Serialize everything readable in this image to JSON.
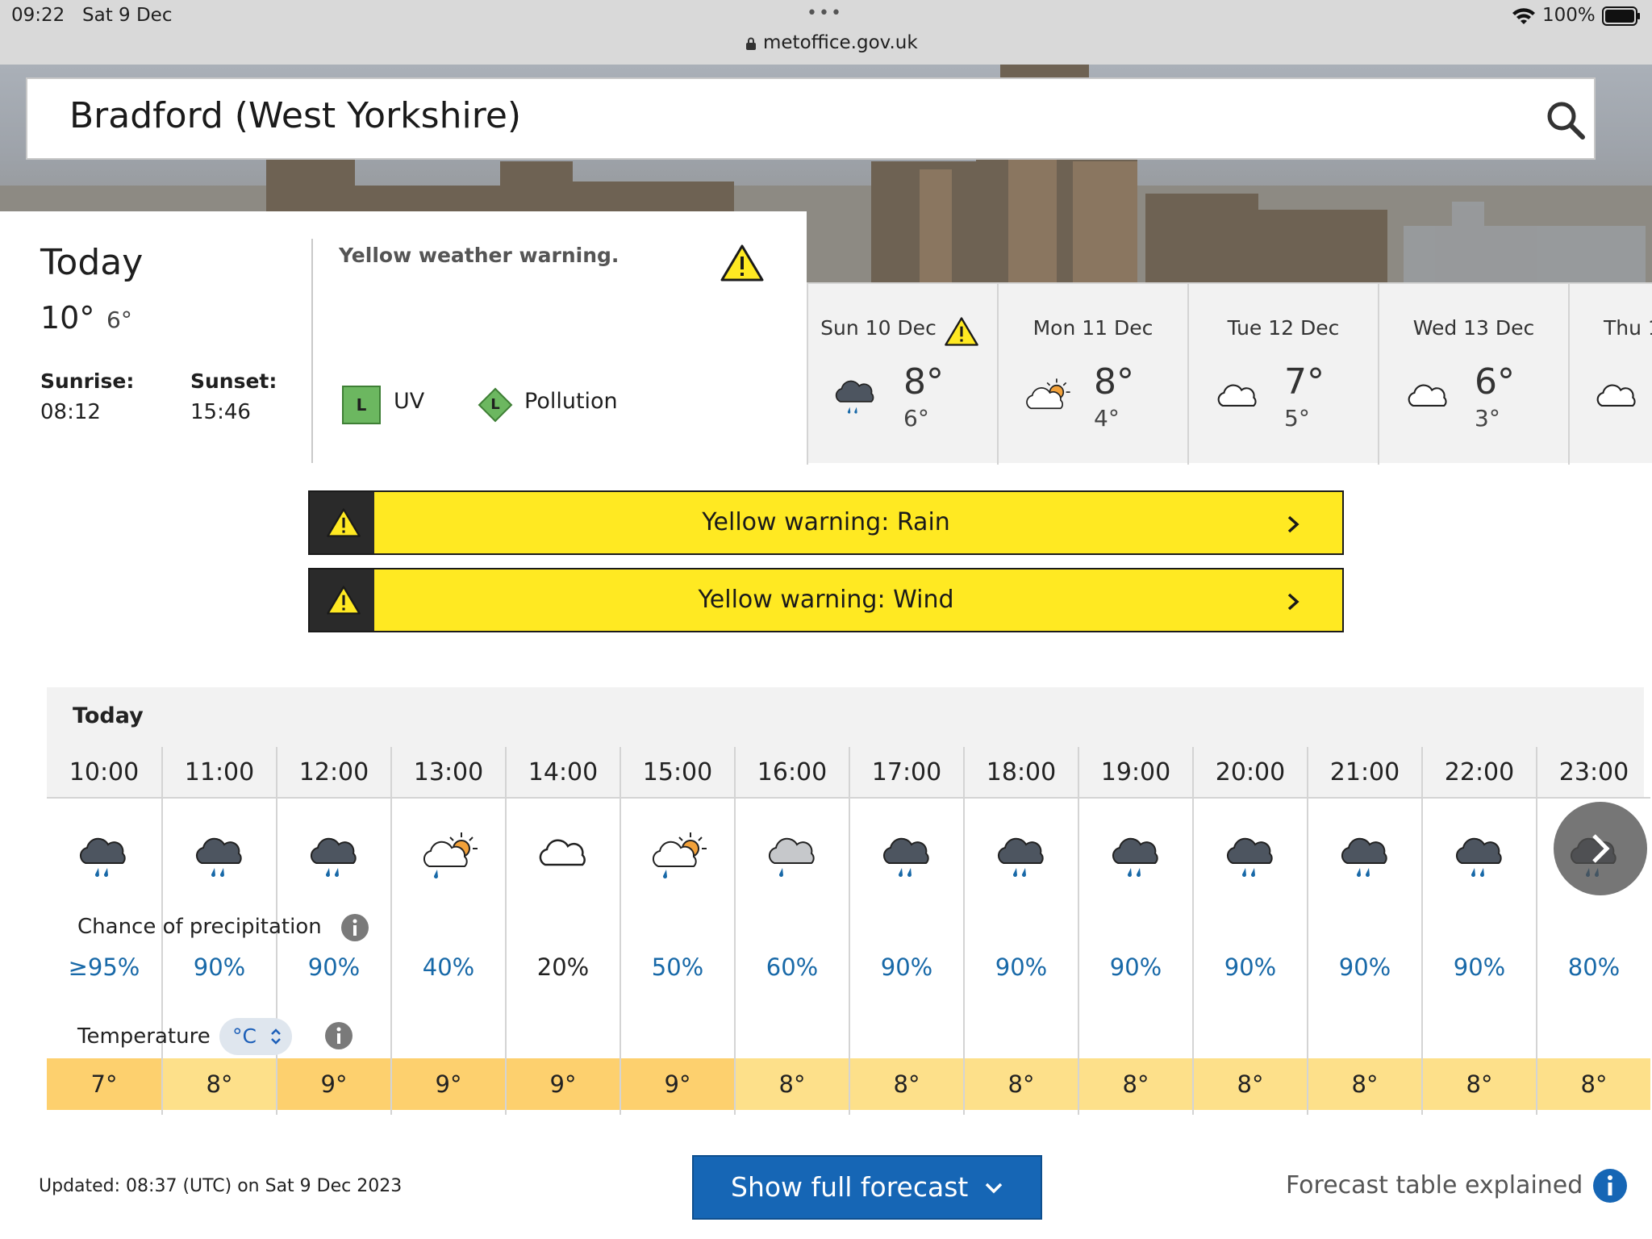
{
  "status_bar": {
    "time": "09:22",
    "date": "Sat 9 Dec",
    "url": "metoffice.gov.uk",
    "battery": "100%"
  },
  "search": {
    "location": "Bradford (West Yorkshire)"
  },
  "today": {
    "title": "Today",
    "high": "10°",
    "low": "6°",
    "sunrise_label": "Sunrise:",
    "sunrise_time": "08:12",
    "sunset_label": "Sunset:",
    "sunset_time": "15:46",
    "warning_text": "Yellow weather warning.",
    "uv_badge": "L",
    "uv_label": "UV",
    "pollution_badge": "L",
    "pollution_label": "Pollution"
  },
  "days": [
    {
      "name": "Sun 10 Dec",
      "high": "8°",
      "low": "6°",
      "icon": "heavy-rain-cloud-icon",
      "warning": true
    },
    {
      "name": "Mon 11 Dec",
      "high": "8°",
      "low": "4°",
      "icon": "sunny-intervals-icon",
      "warning": false
    },
    {
      "name": "Tue 12 Dec",
      "high": "7°",
      "low": "5°",
      "icon": "cloud-icon",
      "warning": false
    },
    {
      "name": "Wed 13 Dec",
      "high": "6°",
      "low": "3°",
      "icon": "cloud-icon",
      "warning": false
    },
    {
      "name": "Thu 1",
      "high": "",
      "low": "",
      "icon": "cloud-icon",
      "warning": false
    }
  ],
  "warnings": [
    {
      "label": "Yellow warning: Rain"
    },
    {
      "label": "Yellow warning: Wind"
    }
  ],
  "hourly": {
    "day_label": "Today",
    "precip_label": "Chance of precipitation",
    "temp_label": "Temperature",
    "unit": "°C",
    "hours": [
      {
        "time": "10:00",
        "icon": "heavy-rain-icon",
        "precip": "≥95%",
        "temp": "7°"
      },
      {
        "time": "11:00",
        "icon": "heavy-rain-icon",
        "precip": "90%",
        "temp": "8°"
      },
      {
        "time": "12:00",
        "icon": "heavy-rain-icon",
        "precip": "90%",
        "temp": "9°"
      },
      {
        "time": "13:00",
        "icon": "sunny-shower-icon",
        "precip": "40%",
        "temp": "9°"
      },
      {
        "time": "14:00",
        "icon": "cloud-icon",
        "precip": "20%",
        "temp": "9°"
      },
      {
        "time": "15:00",
        "icon": "sunny-shower-icon",
        "precip": "50%",
        "temp": "9°"
      },
      {
        "time": "16:00",
        "icon": "light-shower-icon",
        "precip": "60%",
        "temp": "8°"
      },
      {
        "time": "17:00",
        "icon": "heavy-rain-icon",
        "precip": "90%",
        "temp": "8°"
      },
      {
        "time": "18:00",
        "icon": "heavy-rain-icon",
        "precip": "90%",
        "temp": "8°"
      },
      {
        "time": "19:00",
        "icon": "heavy-rain-icon",
        "precip": "90%",
        "temp": "8°"
      },
      {
        "time": "20:00",
        "icon": "heavy-rain-icon",
        "precip": "90%",
        "temp": "8°"
      },
      {
        "time": "21:00",
        "icon": "heavy-rain-icon",
        "precip": "90%",
        "temp": "8°"
      },
      {
        "time": "22:00",
        "icon": "heavy-rain-icon",
        "precip": "90%",
        "temp": "8°"
      },
      {
        "time": "23:00",
        "icon": "heavy-rain-icon",
        "precip": "80%",
        "temp": "8°"
      }
    ]
  },
  "footer": {
    "updated": "Updated: 08:37 (UTC) on Sat 9 Dec 2023",
    "show_forecast": "Show full forecast",
    "table_explained": "Forecast table explained"
  },
  "colors": {
    "warning_yellow": "#ffe922",
    "temp_warm": "#fdd06e",
    "temp_mild": "#fde08a",
    "precip_blue": "#1869a8",
    "button_blue": "#1666b5"
  }
}
